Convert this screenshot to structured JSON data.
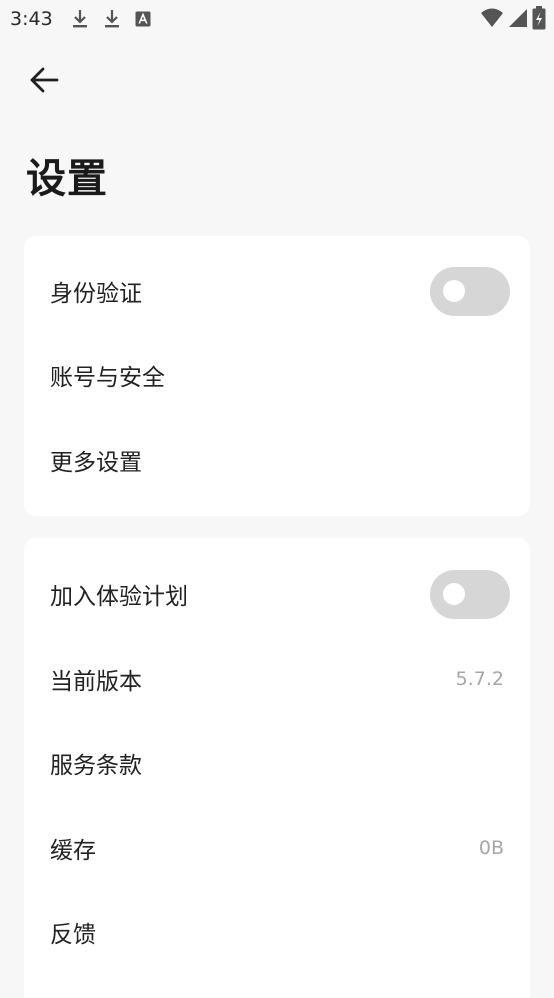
{
  "status_bar": {
    "time": "3:43",
    "left_icons": [
      "download-icon",
      "download-icon",
      "font-notification-icon"
    ],
    "right_icons": [
      "wifi-icon",
      "signal-icon",
      "battery-charging-icon"
    ]
  },
  "header": {
    "back_icon": "arrow-left-icon",
    "title": "设置"
  },
  "card_1": {
    "items": [
      {
        "label": "身份验证",
        "type": "toggle",
        "on": false
      },
      {
        "label": "账号与安全",
        "type": "link"
      },
      {
        "label": "更多设置",
        "type": "link"
      }
    ]
  },
  "card_2": {
    "items": [
      {
        "label": "加入体验计划",
        "type": "toggle",
        "on": false
      },
      {
        "label": "当前版本",
        "type": "value",
        "value": "5.7.2"
      },
      {
        "label": "服务条款",
        "type": "link"
      },
      {
        "label": "缓存",
        "type": "value",
        "value": "0B"
      },
      {
        "label": "反馈",
        "type": "link"
      }
    ]
  },
  "colors": {
    "background": "#f7f7f8",
    "card": "#ffffff",
    "toggle_off": "#d6d6d6",
    "secondary_text": "#a6a6a6"
  }
}
